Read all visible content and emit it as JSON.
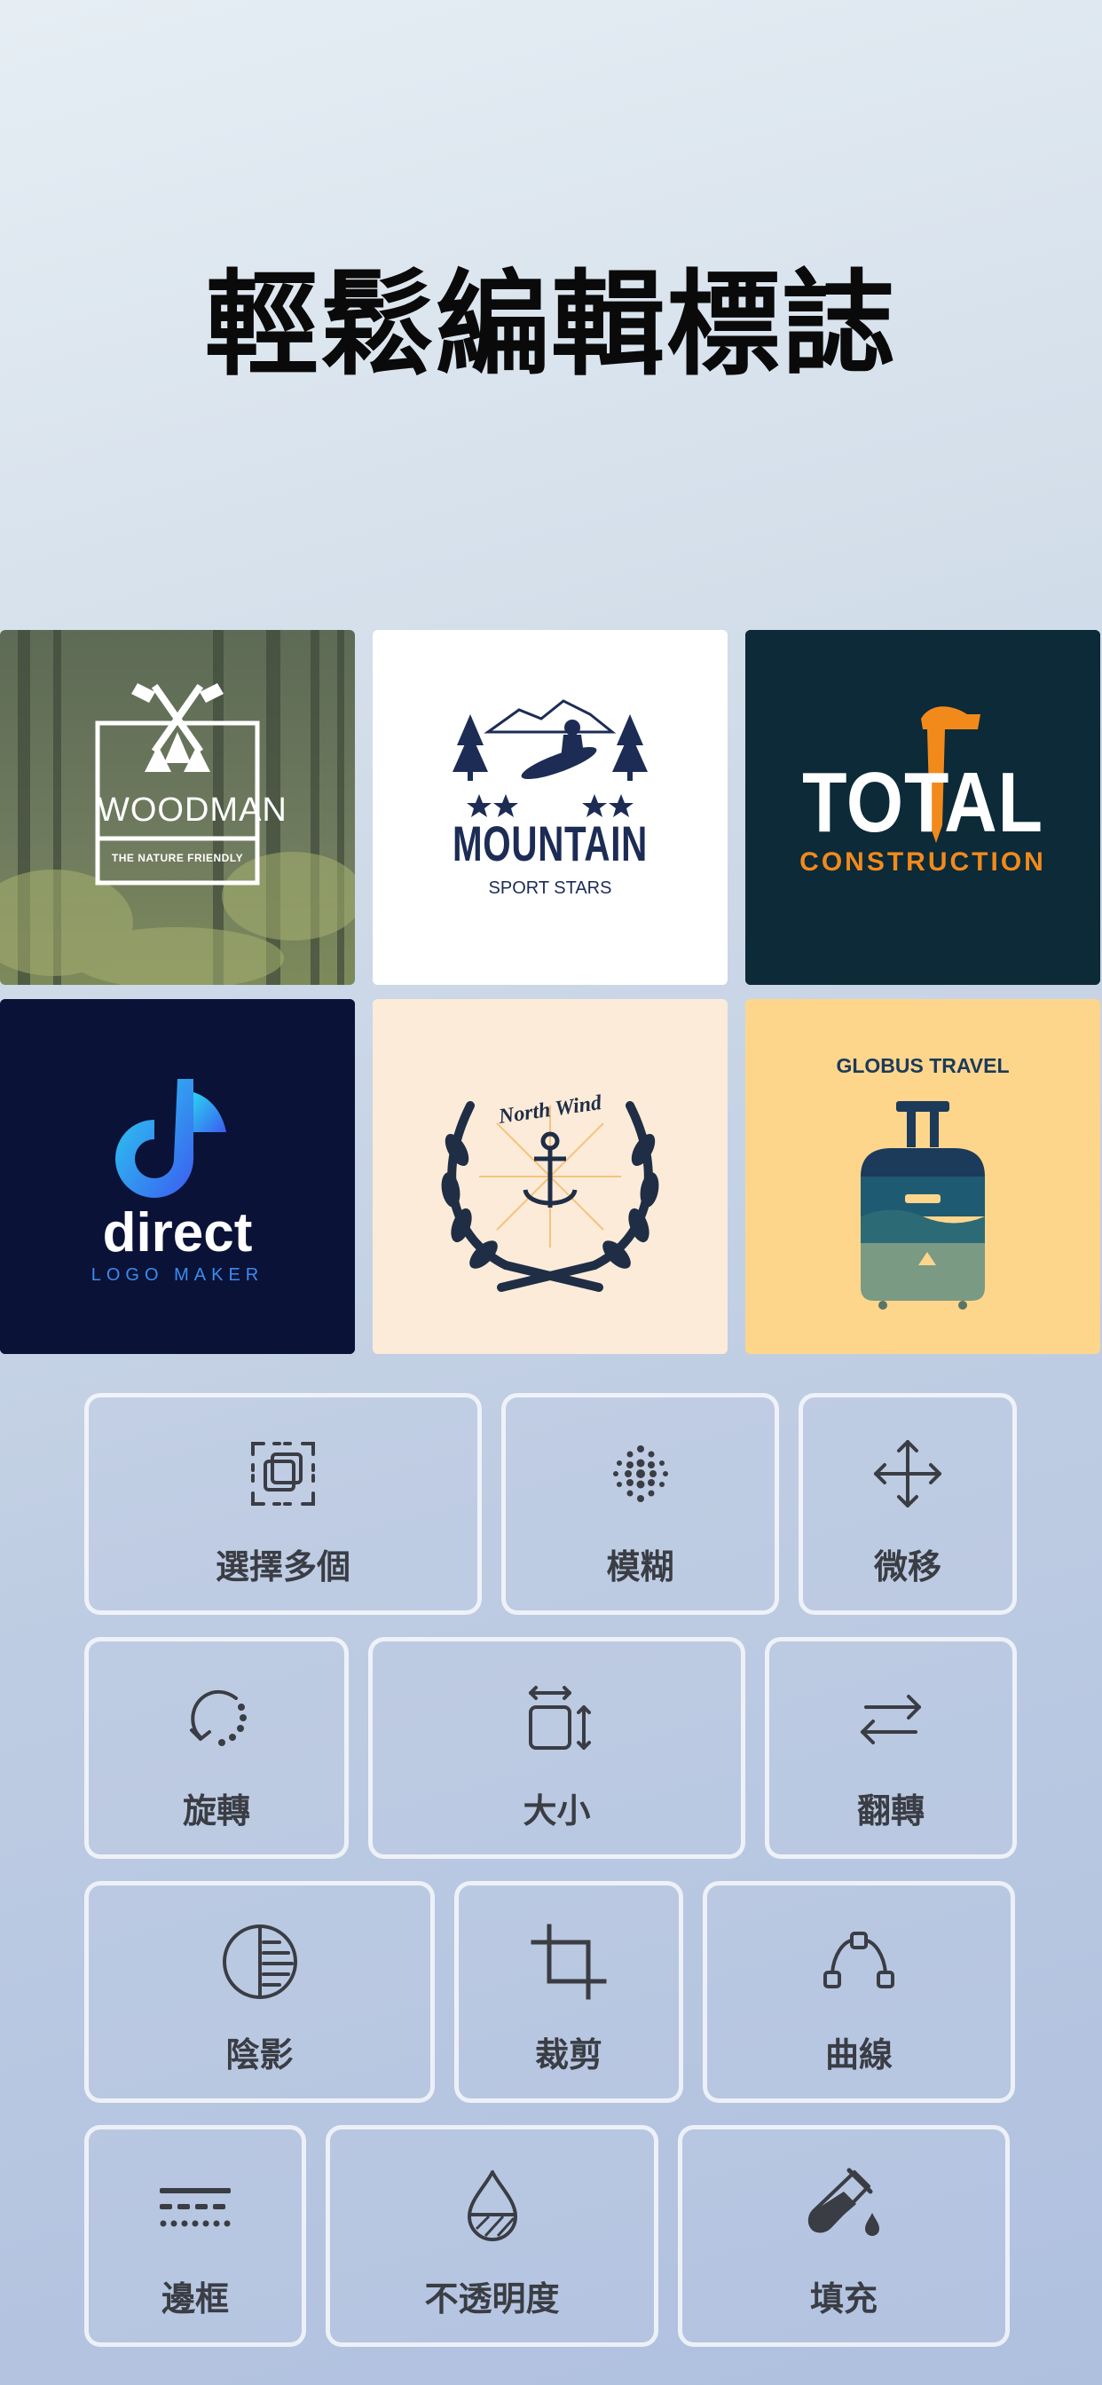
{
  "title": "輕鬆編輯標誌",
  "logos": [
    {
      "name": "WOODMAN",
      "tagline": "THE NATURE FRIENDLY"
    },
    {
      "name": "MOUNTAIN",
      "tagline": "SPORT STARS"
    },
    {
      "name": "TOTAL",
      "tagline": "CONSTRUCTION"
    },
    {
      "name": "direct",
      "tagline": "LOGO MAKER"
    },
    {
      "name": "North Wind",
      "tagline": ""
    },
    {
      "name": "GLOBUS TRAVEL",
      "tagline": ""
    }
  ],
  "tools": [
    {
      "label": "選擇多個",
      "icon": "select-multiple-icon"
    },
    {
      "label": "模糊",
      "icon": "blur-icon"
    },
    {
      "label": "微移",
      "icon": "move-icon"
    },
    {
      "label": "旋轉",
      "icon": "rotate-icon"
    },
    {
      "label": "大小",
      "icon": "resize-icon"
    },
    {
      "label": "翻轉",
      "icon": "flip-icon"
    },
    {
      "label": "陰影",
      "icon": "shadow-icon"
    },
    {
      "label": "裁剪",
      "icon": "crop-icon"
    },
    {
      "label": "曲線",
      "icon": "curve-icon"
    },
    {
      "label": "邊框",
      "icon": "border-icon"
    },
    {
      "label": "不透明度",
      "icon": "opacity-icon"
    },
    {
      "label": "填充",
      "icon": "fill-icon"
    }
  ],
  "colors": {
    "text": "#0a0a0a",
    "tool_label": "#3a3d44",
    "total_bg": "#0c2a38",
    "total_accent": "#f28a1b",
    "direct_bg": "#0a1238",
    "direct_accent": "#3b8cf0",
    "northwind_bg": "#fdebd9",
    "globus_bg": "#fdd68c",
    "mountain_navy": "#1c2c55"
  }
}
